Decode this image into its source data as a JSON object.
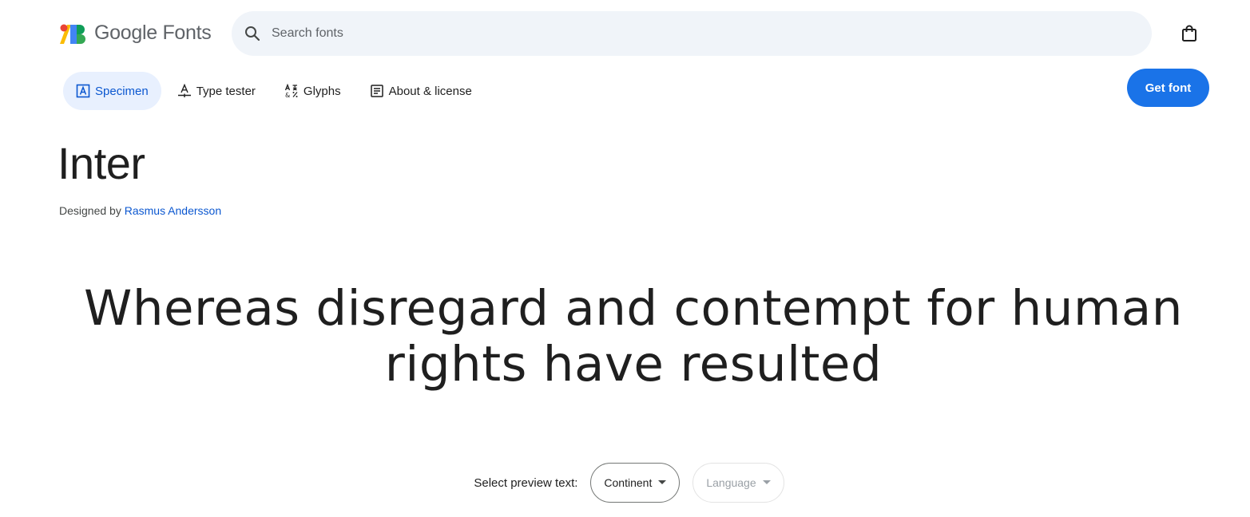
{
  "header": {
    "logo_text": "Google Fonts",
    "search": {
      "placeholder": "Search fonts",
      "value": ""
    }
  },
  "tabs": [
    {
      "label": "Specimen",
      "icon": "specimen-icon",
      "active": true
    },
    {
      "label": "Type tester",
      "icon": "type-tester-icon",
      "active": false
    },
    {
      "label": "Glyphs",
      "icon": "glyphs-icon",
      "active": false
    },
    {
      "label": "About & license",
      "icon": "article-icon",
      "active": false
    }
  ],
  "get_font_label": "Get font",
  "font": {
    "name": "Inter",
    "designed_by_label": "Designed by",
    "designer": "Rasmus Andersson"
  },
  "preview_text": "Whereas disregard and contempt for human rights have resulted",
  "preview_selector": {
    "label": "Select preview text:",
    "continent": "Continent",
    "language": "Language"
  },
  "colors": {
    "accent": "#1a73e8",
    "active_tab_bg": "#e8f0fe",
    "active_tab_text": "#0b57d0",
    "search_bg": "#f0f4f9",
    "link": "#0b57d0"
  }
}
